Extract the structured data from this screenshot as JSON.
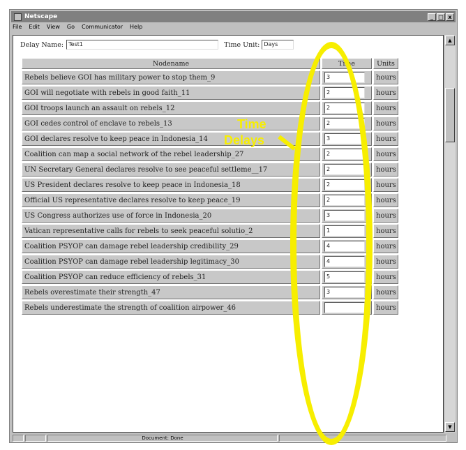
{
  "window": {
    "title": "Netscape",
    "minimize": "_",
    "maximize": "□",
    "close": "x"
  },
  "menu": [
    "File",
    "Edit",
    "View",
    "Go",
    "Communicator",
    "Help"
  ],
  "form": {
    "delay_name_label": "Delay Name:",
    "delay_name_value": "Test1",
    "time_unit_label": "Time Unit:",
    "time_unit_value": "Days"
  },
  "table": {
    "headers": {
      "name": "Nodename",
      "time": "Time",
      "units": "Units"
    },
    "rows": [
      {
        "name": "Rebels believe GOI has military power to stop them_9",
        "time": "3",
        "units": "hours"
      },
      {
        "name": "GOI will negotiate with rebels in good faith_11",
        "time": "2",
        "units": "hours"
      },
      {
        "name": "GOI troops launch an assault on rebels_12",
        "time": "2",
        "units": "hours"
      },
      {
        "name": "GOI cedes control of enclave to rebels_13",
        "time": "2",
        "units": "hours"
      },
      {
        "name": "GOI declares resolve to keep peace in Indonesia_14",
        "time": "3",
        "units": "hours"
      },
      {
        "name": "Coalition can map a social network of the rebel leadership_27",
        "time": "2",
        "units": "hours"
      },
      {
        "name": "UN Secretary General declares resolve to see peaceful settleme__17",
        "time": "2",
        "units": "hours"
      },
      {
        "name": "US President declares resolve to keep peace in Indonesia_18",
        "time": "2",
        "units": "hours"
      },
      {
        "name": "Official US representative declares resolve to keep peace_19",
        "time": "2",
        "units": "hours"
      },
      {
        "name": "US Congress authorizes use of force in Indonesia_20",
        "time": "3",
        "units": "hours"
      },
      {
        "name": "Vatican representative calls for rebels to seek peaceful solutio_2",
        "time": "1",
        "units": "hours"
      },
      {
        "name": "Coalition PSYOP can damage rebel leadership credibility_29",
        "time": "4",
        "units": "hours"
      },
      {
        "name": "Coalition PSYOP can damage rebel leadership legitimacy_30",
        "time": "4",
        "units": "hours"
      },
      {
        "name": "Coalition PSYOP can reduce efficiency of rebels_31",
        "time": "5",
        "units": "hours"
      },
      {
        "name": "Rebels overestimate their strength_47",
        "time": "3",
        "units": "hours"
      },
      {
        "name": "Rebels underestimate the strength of coalition airpower_46",
        "time": "",
        "units": "hours"
      }
    ]
  },
  "status": {
    "text": "Document: Done"
  },
  "annotation": {
    "line1": "Time",
    "line2": "Delays",
    "color": "#f7ee00"
  }
}
